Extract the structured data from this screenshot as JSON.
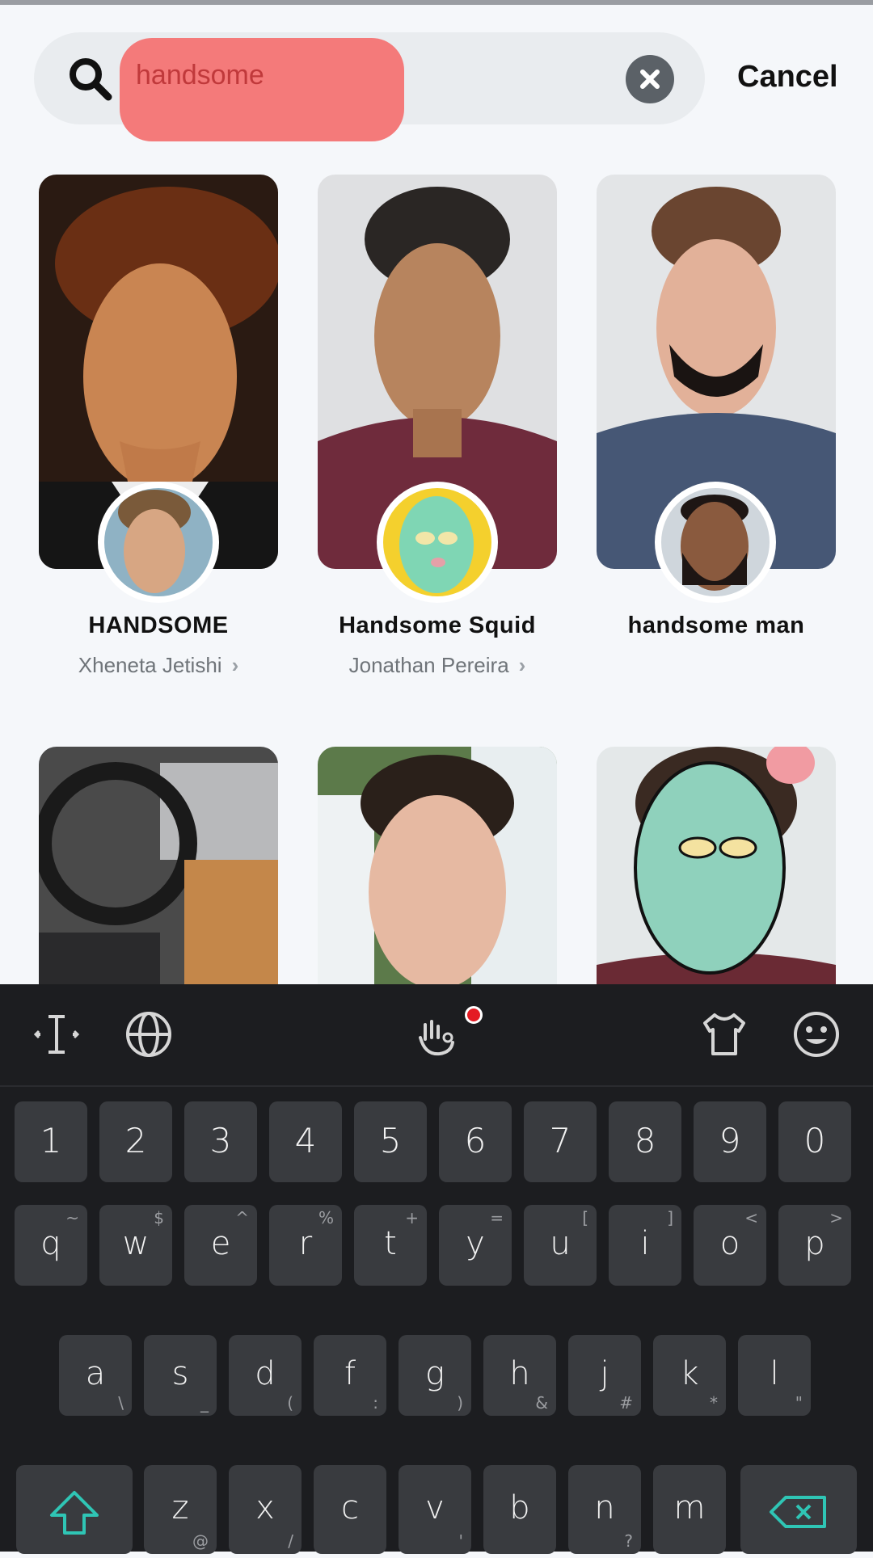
{
  "search": {
    "query": "handsome",
    "cancel_label": "Cancel"
  },
  "results": [
    {
      "name": "HANDSOME",
      "creator": "Xheneta Jetishi"
    },
    {
      "name": "Handsome Squid",
      "creator": "Jonathan Pereira"
    },
    {
      "name": "handsome man",
      "creator": ""
    }
  ],
  "keyboard": {
    "number_row": [
      "1",
      "2",
      "3",
      "4",
      "5",
      "6",
      "7",
      "8",
      "9",
      "0"
    ],
    "row1": [
      {
        "k": "q",
        "s": "~"
      },
      {
        "k": "w",
        "s": "$"
      },
      {
        "k": "e",
        "s": "^"
      },
      {
        "k": "r",
        "s": "%"
      },
      {
        "k": "t",
        "s": "+"
      },
      {
        "k": "y",
        "s": "="
      },
      {
        "k": "u",
        "s": "["
      },
      {
        "k": "i",
        "s": "]"
      },
      {
        "k": "o",
        "s": "<"
      },
      {
        "k": "p",
        "s": ">"
      }
    ],
    "row2": [
      {
        "k": "a",
        "s": "\\"
      },
      {
        "k": "s",
        "s": "_"
      },
      {
        "k": "d",
        "s": "("
      },
      {
        "k": "f",
        "s": ":"
      },
      {
        "k": "g",
        "s": ")"
      },
      {
        "k": "h",
        "s": "&"
      },
      {
        "k": "j",
        "s": "#"
      },
      {
        "k": "k",
        "s": "*"
      },
      {
        "k": "l",
        "s": "\""
      }
    ],
    "row3": [
      {
        "k": "z",
        "s": "@"
      },
      {
        "k": "x",
        "s": "/"
      },
      {
        "k": "c",
        "s": ""
      },
      {
        "k": "v",
        "s": "'"
      },
      {
        "k": "b",
        "s": ""
      },
      {
        "k": "n",
        "s": "?"
      },
      {
        "k": "m",
        "s": ""
      }
    ],
    "toolbar_icons": [
      "cursor-icon",
      "globe-icon",
      "gesture-icon",
      "shirt-icon",
      "emoji-icon"
    ],
    "accent_color": "#2fc5b5"
  }
}
